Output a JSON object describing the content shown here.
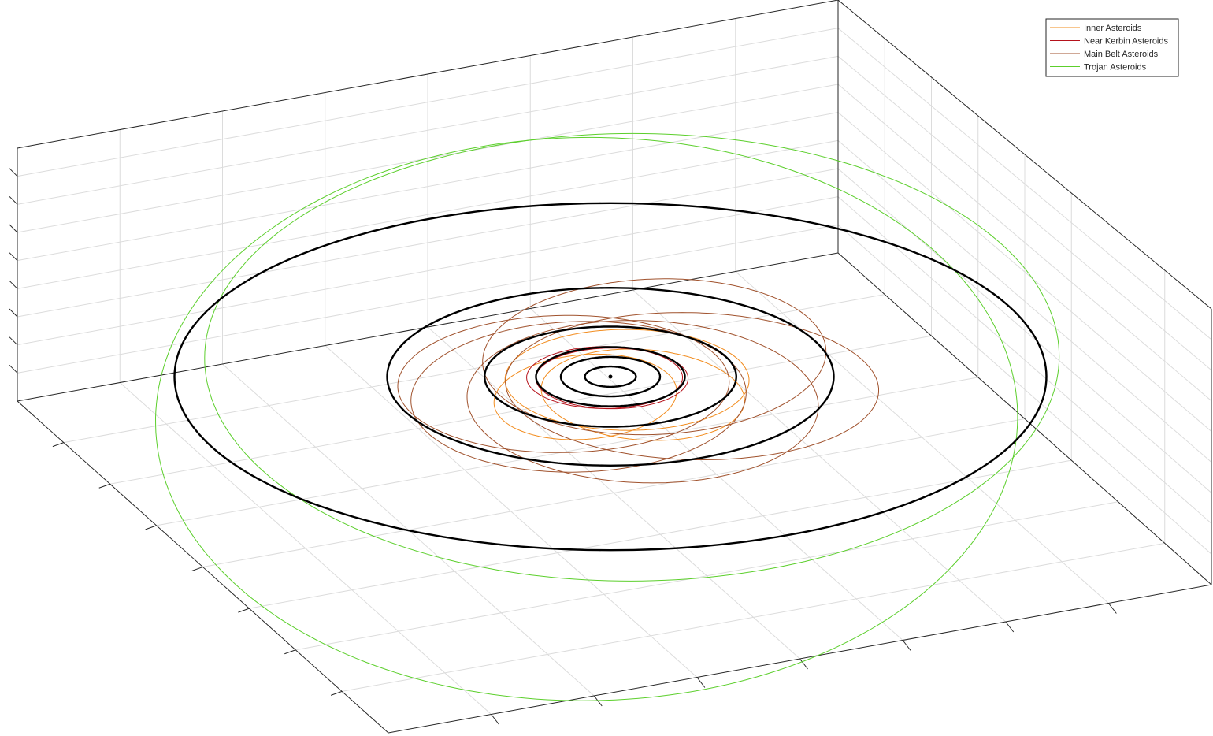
{
  "chart_data": {
    "type": "line",
    "projection": "3d",
    "title": "",
    "xlabel": "",
    "ylabel": "",
    "zlabel": "",
    "grid": true,
    "tick_labels_visible": false,
    "legend_position": "top-right",
    "central_body": {
      "x": 0,
      "y": 0,
      "color": "#000000"
    },
    "reference_orbits": {
      "color": "#000000",
      "radii": [
        0.72,
        1.4,
        2.1,
        3.55,
        6.3,
        12.3
      ]
    },
    "series": [
      {
        "name": "Inner Asteroids",
        "color": "#f28c1e",
        "orbits": [
          {
            "a": 2.9,
            "e": 0.52,
            "omega_deg": 62,
            "tilt": 0.05
          },
          {
            "a": 3.1,
            "e": 0.48,
            "omega_deg": 128,
            "tilt": 0.06
          },
          {
            "a": 3.45,
            "e": 0.15,
            "omega_deg": 155,
            "tilt": 0.03
          }
        ]
      },
      {
        "name": "Near Kerbin Asteroids",
        "color": "#b5121b",
        "orbits": [
          {
            "a": 2.15,
            "e": 0.06,
            "omega_deg": 110,
            "tilt": 0.0
          },
          {
            "a": 2.2,
            "e": 0.08,
            "omega_deg": 20,
            "tilt": 0.0
          }
        ]
      },
      {
        "name": "Main Belt Asteroids",
        "color": "#a0522d",
        "orbits": [
          {
            "a": 5.2,
            "e": 0.35,
            "omega_deg": 120,
            "tilt": 0.08
          },
          {
            "a": 4.9,
            "e": 0.32,
            "omega_deg": 55,
            "tilt": 0.07
          },
          {
            "a": 5.3,
            "e": 0.45,
            "omega_deg": 165,
            "tilt": 0.06
          },
          {
            "a": 4.7,
            "e": 0.3,
            "omega_deg": 20,
            "tilt": 0.05
          },
          {
            "a": 5.0,
            "e": 0.35,
            "omega_deg": 225,
            "tilt": 0.09
          }
        ]
      },
      {
        "name": "Trojan Asteroids",
        "color": "#5ccf2c",
        "orbits": [
          {
            "a": 12.3,
            "e": 0.16,
            "omega_deg": 70,
            "tilt": 0.4
          },
          {
            "a": 12.1,
            "e": 0.1,
            "omega_deg": 240,
            "tilt": 0.2
          }
        ]
      }
    ]
  }
}
